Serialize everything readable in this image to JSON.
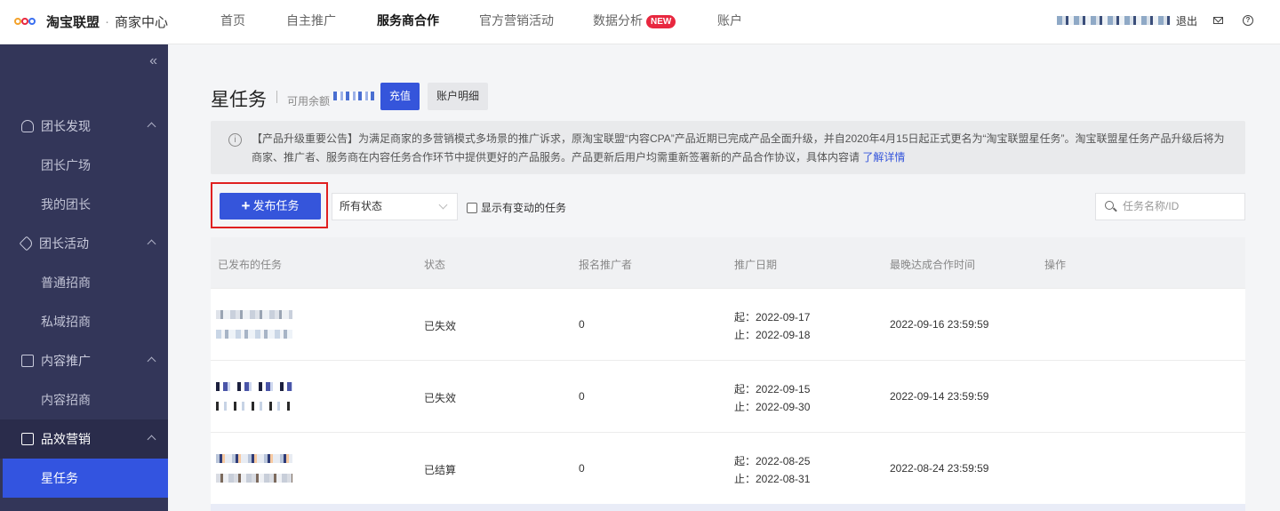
{
  "header": {
    "logo_text": "淘宝联盟",
    "logo_sep": "·",
    "logo_sub": "商家中心",
    "nav": [
      {
        "label": "首页",
        "active": false
      },
      {
        "label": "自主推广",
        "active": false
      },
      {
        "label": "服务商合作",
        "active": true
      },
      {
        "label": "官方营销活动",
        "active": false
      },
      {
        "label": "数据分析",
        "active": false,
        "badge": "NEW"
      },
      {
        "label": "账户",
        "active": false
      }
    ],
    "logout": "退出",
    "mail_icon": "mail-icon",
    "help_icon": "help-icon"
  },
  "sidebar": {
    "collapse_glyph": "«",
    "groups": [
      {
        "label": "团长发现",
        "icon": "user-icon",
        "items": [
          "团长广场",
          "我的团长"
        ]
      },
      {
        "label": "团长活动",
        "icon": "tag-icon",
        "items": [
          "普通招商",
          "私域招商"
        ]
      },
      {
        "label": "内容推广",
        "icon": "doc-icon",
        "items": [
          "内容招商"
        ]
      },
      {
        "label": "品效营销",
        "icon": "file-icon",
        "items": [
          "星任务"
        ]
      }
    ],
    "active_item": "星任务"
  },
  "main": {
    "title": "星任务",
    "balance_label": "可用余额",
    "recharge_label": "充值",
    "account_detail_label": "账户明细",
    "notice": {
      "text": "【产品升级重要公告】为满足商家的多营销模式多场景的推广诉求，原淘宝联盟“内容CPA”产品近期已完成产品全面升级，并自2020年4月15日起正式更名为“淘宝联盟星任务”。淘宝联盟星任务产品升级后将为商家、推广者、服务商在内容任务合作环节中提供更好的产品服务。产品更新后用户均需重新签署新的产品合作协议，具体内容请了解详情。",
      "link": "了解详情"
    },
    "publish_label": "发布任务",
    "status_filter": "所有状态",
    "changed_checkbox_label": "显示有变动的任务",
    "search_placeholder": "任务名称/ID"
  },
  "table": {
    "columns": [
      "已发布的任务",
      "状态",
      "报名推广者",
      "推广日期",
      "最晚达成合作时间",
      "操作"
    ],
    "rows": [
      {
        "status": "已失效",
        "count": "0",
        "start": "起：2022-09-17",
        "end": "止：2022-09-18",
        "deadline": "2022-09-16 23:59:59"
      },
      {
        "status": "已失效",
        "count": "0",
        "start": "起：2022-09-15",
        "end": "止：2022-09-30",
        "deadline": "2022-09-14 23:59:59"
      },
      {
        "status": "已结算",
        "count": "0",
        "start": "起：2022-08-25",
        "end": "止：2022-08-31",
        "deadline": "2022-08-24 23:59:59"
      }
    ]
  },
  "colors": {
    "primary": "#3555db",
    "sidebar_bg": "#333659",
    "highlight_border": "#e02020",
    "new_badge": "#e8273f"
  }
}
